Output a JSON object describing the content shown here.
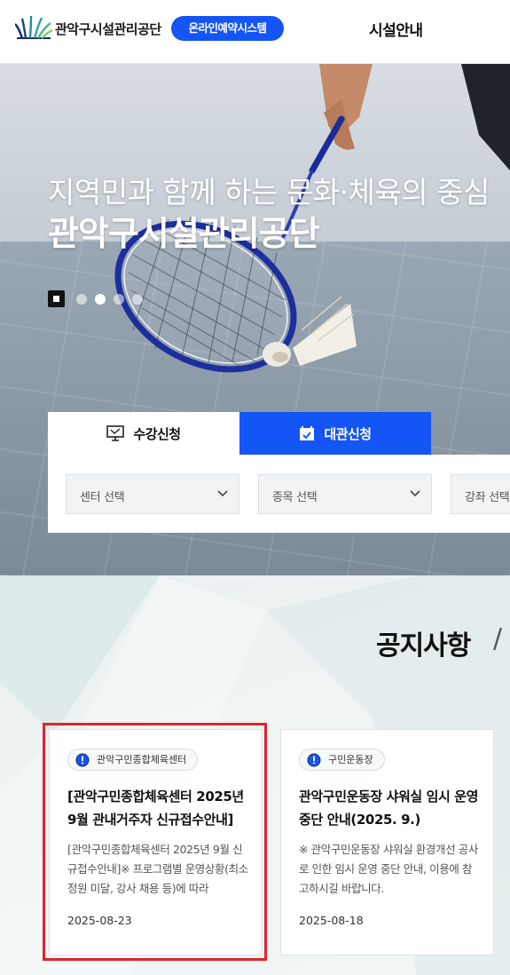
{
  "header": {
    "org_name": "관악구시설관리공단",
    "online_button": "온라인예약시스템",
    "nav_item": "시설안내"
  },
  "hero": {
    "title_line1": "지역민과 함께 하는 문화·체육의 중심",
    "title_line2": "관악구시설관리공단",
    "slide_count": 4,
    "active_slide": 2
  },
  "tabs": {
    "apply_label": "수강신청",
    "rent_label": "대관신청"
  },
  "search": {
    "center_select": "센터 선택",
    "sport_select": "종목 선택",
    "course_select": "강좌 선택"
  },
  "notices": {
    "section_title": "공지사항",
    "slash": "/",
    "items": [
      {
        "badge": "관악구민종합체육센터",
        "title": "[관악구민종합체육센터 2025년 9월 관내거주자 신규접수안내]",
        "desc": "[관악구민종합체육센터 2025년 9월 신규접수안내]※ 프로그램별 운영상황(최소정원 미달, 강사 채용 등)에 따라",
        "date": "2025-08-23"
      },
      {
        "badge": "구민운동장",
        "title": "관악구민운동장 샤워실 임시 운영 중단 안내(2025. 9.)",
        "desc": "※ 관악구민운동장 샤워실 환경개선 공사로 인한 임시 운영 중단 안내, 이용에 참고하시길 바랍니다.",
        "date": "2025-08-18"
      }
    ]
  },
  "colors": {
    "brand_blue": "#1455f5",
    "highlight_red": "#e0242b",
    "logo_teal": "#1f8f9a",
    "logo_navy": "#0d2a6b"
  },
  "icons": {
    "logo": "fan-leaf-logo",
    "apply_tab": "monitor-icon",
    "rent_tab": "calendar-check-icon",
    "select": "chevron-down-icon",
    "badge": "info-circle-icon",
    "hero_pause": "pause-icon"
  }
}
